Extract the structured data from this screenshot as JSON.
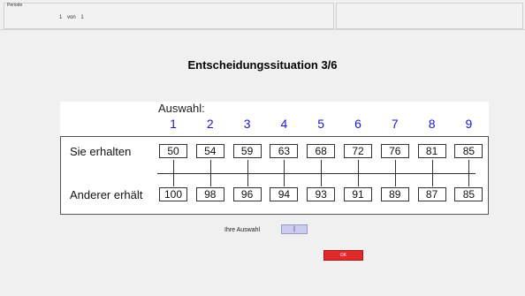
{
  "header": {
    "period_label": "Periode",
    "period_value": "1 von 1"
  },
  "title": "Entscheidungssituation 3/6",
  "decision": {
    "auswahl_label": "Auswahl:",
    "options": [
      "1",
      "2",
      "3",
      "4",
      "5",
      "6",
      "7",
      "8",
      "9"
    ],
    "row_you_label": "Sie erhalten",
    "row_other_label": "Anderer erhält",
    "you_values": [
      "50",
      "54",
      "59",
      "63",
      "68",
      "72",
      "76",
      "81",
      "85"
    ],
    "other_values": [
      "100",
      "98",
      "96",
      "94",
      "93",
      "91",
      "89",
      "87",
      "85"
    ]
  },
  "choice": {
    "label": "Ihre Auswahl",
    "value": "|"
  },
  "ok_label": "OK",
  "colors": {
    "option_number": "#1a1acc",
    "ok_button": "#e02a2a",
    "input_background": "#ccccf2"
  }
}
